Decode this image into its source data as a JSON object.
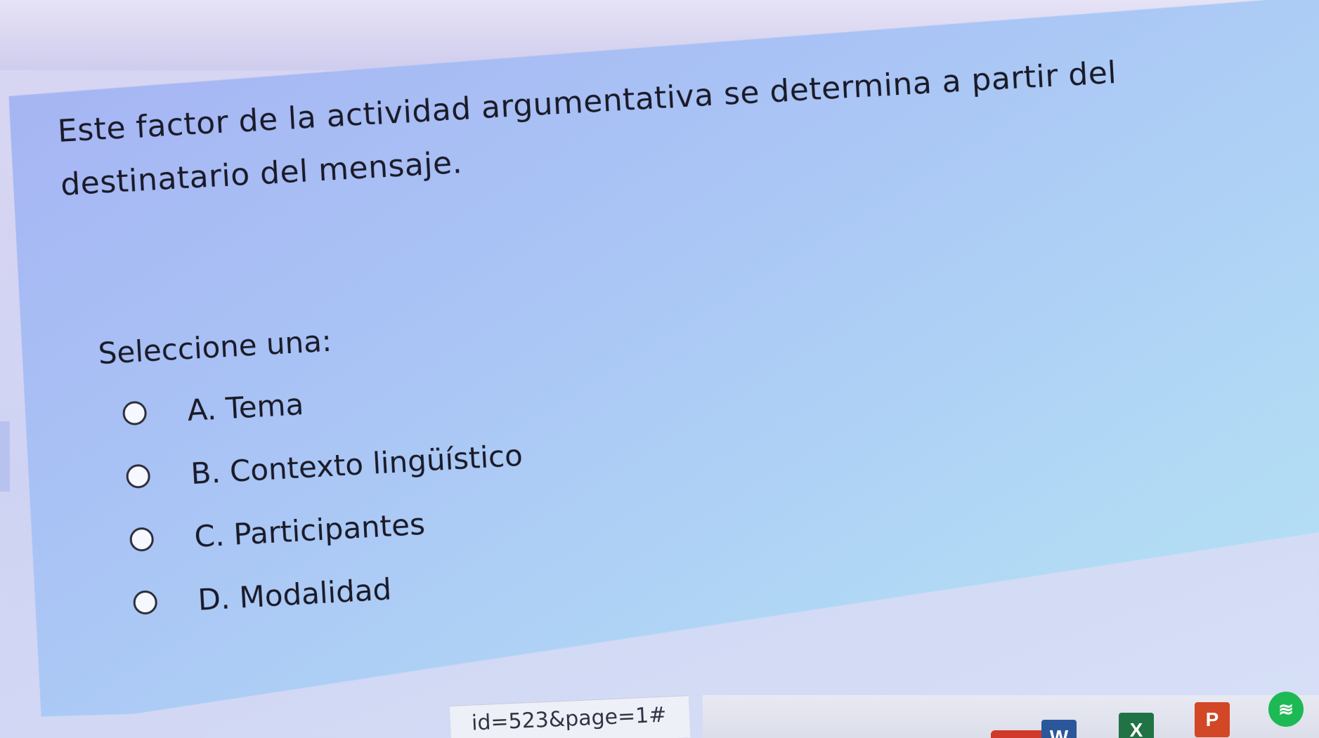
{
  "question": {
    "text": "Este factor de la actividad argumentativa se determina a partir del destinatario del mensaje.",
    "prompt": "Seleccione una:",
    "options": [
      {
        "label": "A. Tema"
      },
      {
        "label": "B. Contexto lingüístico"
      },
      {
        "label": "C. Participantes"
      },
      {
        "label": "D. Modalidad"
      }
    ]
  },
  "status_bar": {
    "url_fragment": "id=523&page=1#"
  },
  "taskbar": {
    "word_letter": "W",
    "excel_letter": "X",
    "ppt_letter": "P"
  },
  "icons": [
    "word-icon",
    "excel-icon",
    "powerpoint-icon",
    "spotify-icon"
  ],
  "colors": {
    "card_bg": "#a9c3f5",
    "text": "#1a1a28",
    "word": "#2b579a",
    "excel": "#217346",
    "powerpoint": "#d24726",
    "spotify": "#1db954"
  }
}
